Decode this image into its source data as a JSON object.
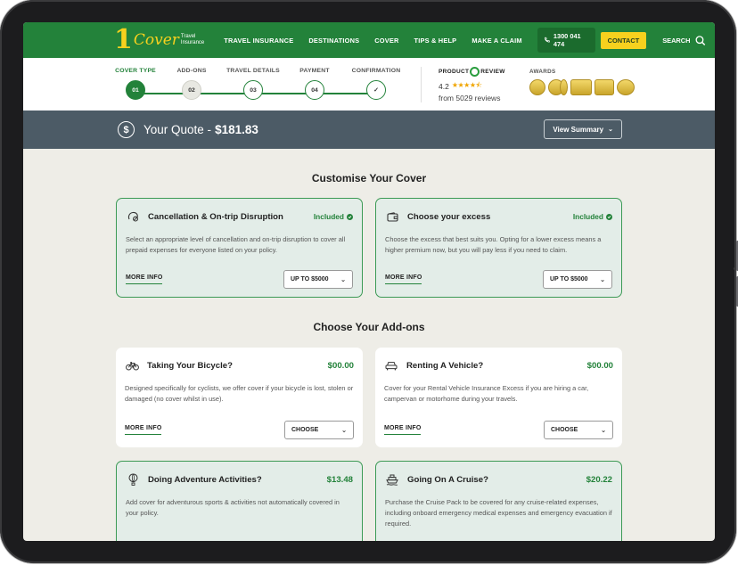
{
  "nav": {
    "logo_number": "1",
    "logo_word": "Cover",
    "logo_sub1": "Travel",
    "logo_sub2": "Insurance",
    "items": [
      "TRAVEL INSURANCE",
      "DESTINATIONS",
      "COVER",
      "TIPS & HELP",
      "MAKE A CLAIM"
    ],
    "phone": "1300 041 474",
    "contact": "CONTACT",
    "search": "SEARCH"
  },
  "steps": [
    {
      "label": "COVER TYPE",
      "marker": "01",
      "state": "active"
    },
    {
      "label": "ADD-ONS",
      "marker": "02",
      "state": "next"
    },
    {
      "label": "TRAVEL DETAILS",
      "marker": "03",
      "state": "todo"
    },
    {
      "label": "PAYMENT",
      "marker": "04",
      "state": "todo"
    },
    {
      "label": "CONFIRMATION",
      "marker": "✓",
      "state": "todo"
    }
  ],
  "review": {
    "brand_left": "PRODUCT",
    "brand_right": "REVIEW",
    "rating": "4.2",
    "stars": 4.2,
    "count_text": "from 5029 reviews"
  },
  "awards": {
    "label": "AWARDS"
  },
  "quote": {
    "label": "Your Quote - ",
    "price": "$181.83",
    "summary_button": "View Summary"
  },
  "customise": {
    "title": "Customise Your Cover",
    "cards": [
      {
        "icon": "cancellation-icon",
        "title": "Cancellation & On-trip Disruption",
        "status": "Included",
        "desc": "Select an appropriate level of cancellation and on-trip disruption to cover all prepaid expenses for everyone listed on your policy.",
        "more": "MORE INFO",
        "select": "UP TO $5000"
      },
      {
        "icon": "wallet-icon",
        "title": "Choose your excess",
        "status": "Included",
        "desc": "Choose the excess that best suits you. Opting for a lower excess means a higher premium now, but you will pay less if you need to claim.",
        "more": "MORE INFO",
        "select": "UP TO $5000"
      }
    ]
  },
  "addons": {
    "title": "Choose Your Add-ons",
    "cards": [
      {
        "icon": "bicycle-icon",
        "title": "Taking Your Bicycle?",
        "price": "$00.00",
        "desc": "Designed specifically for cyclists, we offer cover if your bicycle is lost, stolen or damaged (no cover whilst in use).",
        "more": "MORE INFO",
        "select": "CHOOSE"
      },
      {
        "icon": "car-icon",
        "title": "Renting A Vehicle?",
        "price": "$00.00",
        "desc": "Cover for your Rental Vehicle Insurance Excess if you are hiring a car, campervan or motorhome during your travels.",
        "more": "MORE INFO",
        "select": "CHOOSE"
      },
      {
        "icon": "balloon-icon",
        "title": "Doing Adventure Activities?",
        "price": "$13.48",
        "desc": "Add cover for adventurous sports & activities not automatically covered in your policy."
      },
      {
        "icon": "ship-icon",
        "title": "Going On A Cruise?",
        "price": "$20.22",
        "desc": "Purchase the Cruise Pack to be covered for any cruise-related expenses, including onboard emergency medical expenses and emergency evacuation if required."
      }
    ]
  },
  "colors": {
    "brand_green": "#23823a",
    "brand_yellow": "#f7d11e",
    "quote_bar": "#4c5b66",
    "page_bg": "#eeede7"
  }
}
